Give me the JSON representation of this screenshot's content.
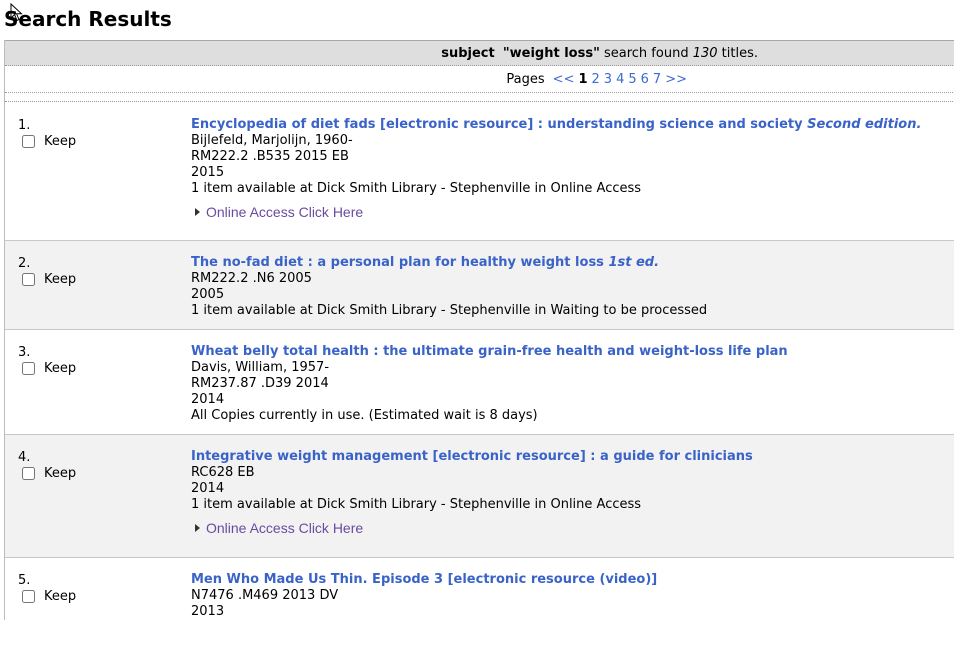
{
  "page": {
    "title": "Search Results"
  },
  "summary": {
    "field": "subject",
    "query": "\"weight loss\"",
    "middle": " search found ",
    "count": "130",
    "suffix": " titles."
  },
  "pager": {
    "label": "Pages",
    "prev": "<<",
    "current": "1",
    "pages": [
      "2",
      "3",
      "4",
      "5",
      "6",
      "7"
    ],
    "next": ">>"
  },
  "keep_label": "Keep",
  "online_access_label": "Online Access Click Here",
  "results": [
    {
      "number": "1.",
      "title": "Encyclopedia of diet fads [electronic resource] : understanding science and society",
      "edition": "Second edition.",
      "lines": [
        "Bijlefeld, Marjolijn, 1960-",
        "RM222.2 .B535 2015 EB",
        "2015",
        "1 item available at Dick Smith Library - Stephenville in Online Access"
      ],
      "online": true
    },
    {
      "number": "2.",
      "title": "The no-fad diet : a personal plan for healthy weight loss",
      "edition": "1st ed.",
      "lines": [
        "RM222.2 .N6 2005",
        "2005",
        "1 item available at Dick Smith Library - Stephenville in Waiting to be processed"
      ],
      "online": false
    },
    {
      "number": "3.",
      "title": "Wheat belly total health : the ultimate grain-free health and weight-loss life plan",
      "edition": "",
      "lines": [
        "Davis, William, 1957-",
        "RM237.87 .D39 2014",
        "2014",
        "All Copies currently in use. (Estimated wait is 8 days)"
      ],
      "online": false
    },
    {
      "number": "4.",
      "title": "Integrative weight management [electronic resource] : a guide for clinicians",
      "edition": "",
      "lines": [
        "RC628 EB",
        "2014",
        "1 item available at Dick Smith Library - Stephenville in Online Access"
      ],
      "online": true
    },
    {
      "number": "5.",
      "title": "Men Who Made Us Thin. Episode 3 [electronic resource (video)]",
      "edition": "",
      "lines": [
        "N7476 .M469 2013 DV",
        "2013"
      ],
      "online": false
    }
  ]
}
